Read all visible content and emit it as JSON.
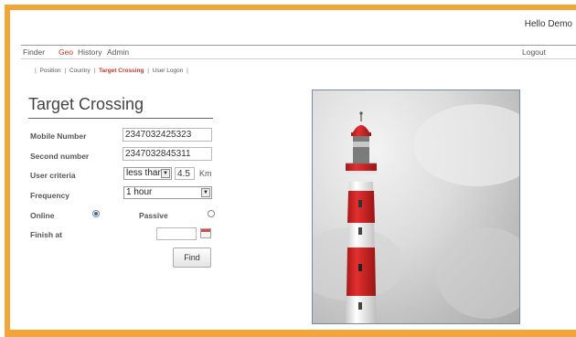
{
  "header": {
    "greeting": "Hello Demo"
  },
  "topnav": {
    "items": [
      "Finder",
      "Geo",
      "History",
      "Admin"
    ],
    "active": "Geo",
    "logout": "Logout"
  },
  "subnav": {
    "items": [
      "Position",
      "Country",
      "Target Crossing",
      "User Logon"
    ],
    "active": "Target Crossing"
  },
  "form": {
    "title": "Target Crossing",
    "mobile_label": "Mobile Number",
    "mobile_value": "2347032425323",
    "second_label": "Second number",
    "second_value": "2347032845311",
    "criteria_label": "User criteria",
    "criteria_operator": "less than",
    "criteria_value": "4.5",
    "criteria_unit": "Km",
    "frequency_label": "Frequency",
    "frequency_value": "1 hour",
    "online_label": "Online",
    "passive_label": "Passive",
    "finish_label": "Finish at",
    "finish_value": "",
    "find_label": "Find"
  },
  "image": {
    "subject": "lighthouse-photo"
  },
  "colors": {
    "accent": "#f3a53a",
    "active_link": "#c0392b",
    "lighthouse_red": "#d9252a"
  },
  "icons": {
    "calendar": "calendar-icon",
    "dropdown": "chevron-down-icon"
  }
}
